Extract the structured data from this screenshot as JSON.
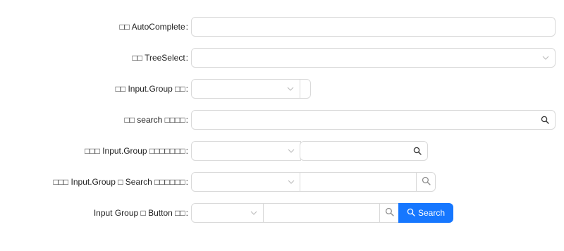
{
  "form": {
    "rows": [
      {
        "label": "□□ AutoComplete"
      },
      {
        "label": "□□ TreeSelect"
      },
      {
        "label": "□□ Input.Group □□"
      },
      {
        "label": "□□ search □□□□"
      },
      {
        "label": "□□□ Input.Group □□□□□□□"
      },
      {
        "label": "□□□ Input.Group □ Search □□□□□□"
      },
      {
        "label": "Input Group □ Button □□"
      }
    ],
    "colon": ":",
    "search_button_label": "Search"
  },
  "colors": {
    "border": "#d9d9d9",
    "primary": "#1677ff",
    "icon": "#bfbfbf",
    "text": "rgba(0,0,0,0.88)"
  },
  "icons": [
    "chevron-down-icon",
    "search-icon"
  ]
}
